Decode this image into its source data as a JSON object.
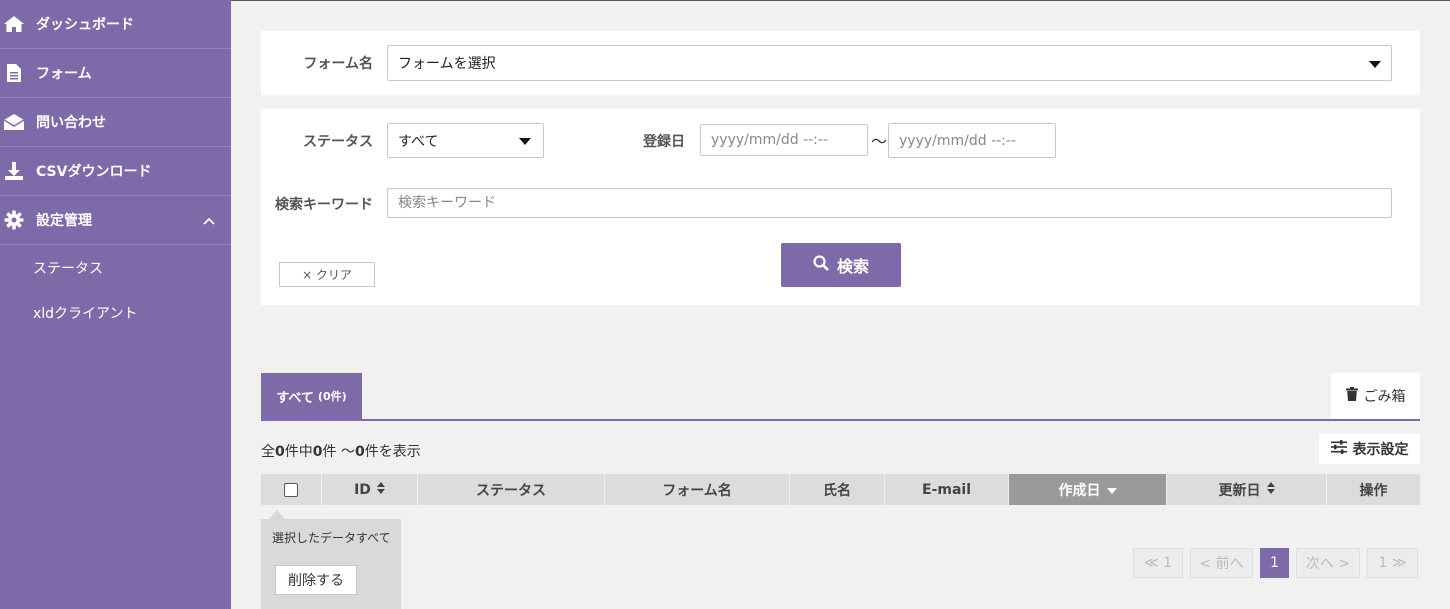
{
  "sidebar": {
    "items": [
      {
        "label": "ダッシュボード",
        "icon": "home-icon"
      },
      {
        "label": "フォーム",
        "icon": "document-icon"
      },
      {
        "label": "問い合わせ",
        "icon": "envelope-icon"
      },
      {
        "label": "CSVダウンロード",
        "icon": "download-icon"
      },
      {
        "label": "設定管理",
        "icon": "gear-icon"
      }
    ],
    "sub_items": [
      {
        "label": "ステータス"
      },
      {
        "label": "xldクライアント"
      }
    ]
  },
  "search": {
    "form_label": "フォーム名",
    "form_value": "フォームを選択",
    "status_label": "ステータス",
    "status_value": "すべて",
    "date_label": "登録日",
    "date_from_placeholder": "yyyy/mm/dd --:--",
    "date_to_placeholder": "yyyy/mm/dd --:--",
    "date_separator": "〜",
    "keyword_label": "検索キーワード",
    "keyword_placeholder": "検索キーワード",
    "clear_label": "× クリア",
    "search_label": "検索"
  },
  "tabs": {
    "active_label": "すべて",
    "active_count": "(0件)",
    "trash_label": "ごみ箱"
  },
  "summary": {
    "prefix": "全",
    "total": "0",
    "mid1": "件中",
    "from": "0",
    "mid2": "件 〜",
    "to": "0",
    "suffix": "件を表示"
  },
  "display_settings_label": "表示設定",
  "table": {
    "columns": [
      {
        "label": "ID",
        "sort": "both"
      },
      {
        "label": "ステータス",
        "sort": ""
      },
      {
        "label": "フォーム名",
        "sort": ""
      },
      {
        "label": "氏名",
        "sort": ""
      },
      {
        "label": "E-mail",
        "sort": ""
      },
      {
        "label": "作成日",
        "sort": "desc"
      },
      {
        "label": "更新日",
        "sort": "both"
      },
      {
        "label": "操作",
        "sort": ""
      }
    ]
  },
  "bulk": {
    "title": "選択したデータすべて",
    "delete_label": "削除する"
  },
  "pagination": {
    "first": "≪ 1",
    "prev": "< 前へ",
    "current": "1",
    "next": "次へ >",
    "last": "1 ≫"
  },
  "colors": {
    "accent": "#7e6aa8",
    "sorted_header": "#9a9a9a"
  }
}
